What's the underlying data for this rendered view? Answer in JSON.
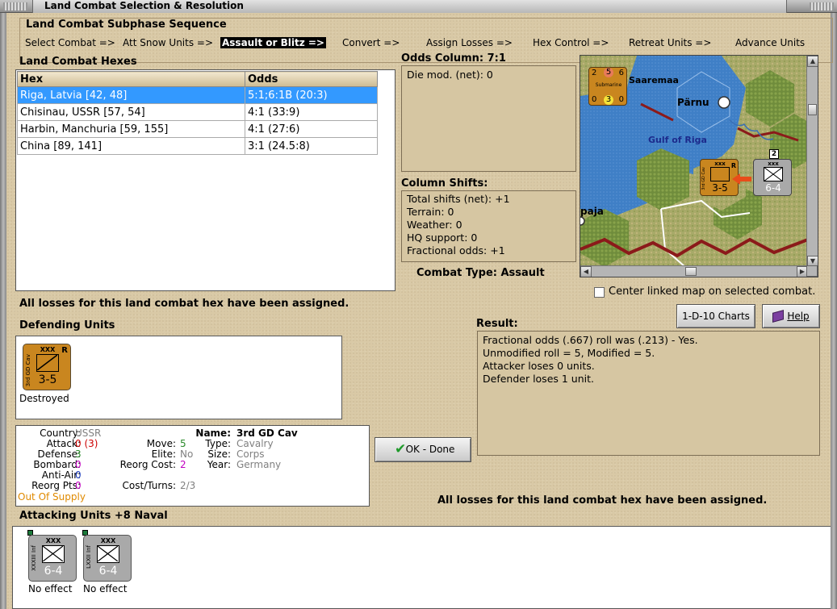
{
  "window": {
    "title": "Land Combat Selection & Resolution"
  },
  "sequence": {
    "title": "Land Combat Subphase Sequence",
    "steps": [
      {
        "label": "Select Combat =>"
      },
      {
        "label": "Att Snow Units =>"
      },
      {
        "label": "Assault or Blitz =>",
        "active": true
      },
      {
        "label": "Convert =>"
      },
      {
        "label": "Assign Losses =>"
      },
      {
        "label": "Hex Control =>"
      },
      {
        "label": "Retreat Units =>"
      },
      {
        "label": "Advance Units"
      }
    ]
  },
  "hexes": {
    "title": "Land Combat Hexes",
    "columns": [
      "Hex",
      "Odds"
    ],
    "rows": [
      {
        "hex": "Riga, Latvia [42, 48]",
        "odds": "5:1;6:1B (20:3)",
        "selected": true
      },
      {
        "hex": "Chisinau, USSR [57, 54]",
        "odds": "4:1 (33:9)"
      },
      {
        "hex": "Harbin, Manchuria [59, 155]",
        "odds": "4:1 (27:6)"
      },
      {
        "hex": "China [89, 141]",
        "odds": "3:1 (24.5:8)"
      }
    ]
  },
  "odds_column": {
    "title": "Odds Column: 7:1",
    "lines": [
      "Die mod. (net): 0"
    ]
  },
  "column_shifts": {
    "title": "Column Shifts:",
    "lines": [
      "Total shifts (net): +1",
      "Terrain: 0",
      "Weather: 0",
      "HQ support: 0",
      "Fractional odds: +1"
    ]
  },
  "combat_type": "Combat Type:  Assault",
  "map": {
    "labels": [
      "Saaremaa",
      "Pärnu",
      "Gulf of Riga",
      "paja"
    ],
    "counters": {
      "submarine": {
        "type": "Submarine",
        "top": [
          "2",
          "5",
          "6"
        ],
        "bottom": [
          "0",
          "3",
          "0"
        ]
      },
      "defender": {
        "size": "xxx",
        "strength": "3-5",
        "side": "3rd GD Cav",
        "flag": "R"
      },
      "attacker": {
        "size": "xxx",
        "strength": "6-4",
        "stack": "2"
      }
    }
  },
  "center_map_label": "Center linked map on selected combat.",
  "buttons": {
    "charts": "1-D-10 Charts",
    "help": "Help",
    "ok": "OK - Done"
  },
  "losses_assigned": "All losses for this land combat hex have been assigned.",
  "defending": {
    "title": "Defending Units",
    "units": [
      {
        "size": "XXX",
        "strength": "3-5",
        "side": "3rd GD Cav",
        "flag": "R",
        "status": "Destroyed"
      }
    ]
  },
  "result": {
    "title": "Result:",
    "lines": [
      "Fractional odds (.667) roll was (.213)  - Yes.",
      "Unmodified roll = 5, Modified = 5.",
      "Attacker loses 0 units.",
      "Defender loses 1 unit."
    ]
  },
  "unit_info": {
    "country_k": "Country:",
    "country_v": "USSR",
    "attack_k": "Attack:",
    "attack_v": "0",
    "attack_v2": "(3)",
    "defense_k": "Defense:",
    "defense_v": "3",
    "bombard_k": "Bombard:",
    "bombard_v": "0",
    "antiair_k": "Anti-Air:",
    "antiair_v": "0",
    "reorgpts_k": "Reorg Pts:",
    "reorgpts_v": "0",
    "supply": "Out Of Supply",
    "move_k": "Move:",
    "move_v": "5",
    "elite_k": "Elite:",
    "elite_v": "No",
    "reorgcost_k": "Reorg Cost:",
    "reorgcost_v": "2",
    "costturns_k": "Cost/Turns:",
    "costturns_v": "2/3",
    "name_k": "Name:",
    "name_v": "3rd GD Cav",
    "type_k": "Type:",
    "type_v": "Cavalry",
    "size_k": "Size:",
    "size_v": "Corps",
    "year_k": "Year:",
    "year_v": "Germany"
  },
  "attacking": {
    "title": "Attacking Units +8 Naval",
    "units": [
      {
        "size": "XXX",
        "strength": "6-4",
        "side": "XXXIII Inf",
        "status": "No effect"
      },
      {
        "size": "XXX",
        "strength": "6-4",
        "side": "LXXII Inf",
        "status": "No effect"
      }
    ]
  },
  "colors": {
    "selection": "#3399ff",
    "counter_orange": "#c9861f",
    "counter_gray": "#a9a9a9",
    "attack_red": "#cc0000",
    "defense_green": "#2a8a2a",
    "supply_orange": "#e08a00",
    "gray_text": "#808080"
  }
}
